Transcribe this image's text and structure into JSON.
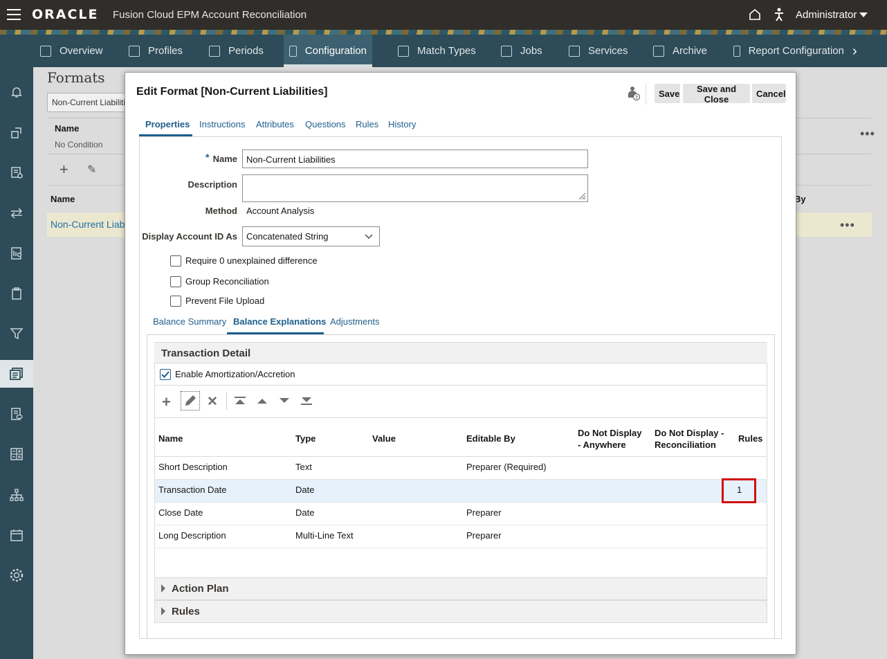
{
  "header": {
    "logo": "ORACLE",
    "app_title": "Fusion Cloud EPM Account Reconciliation",
    "user": "Administrator",
    "icons": [
      "menu-icon",
      "home-icon",
      "accessibility-icon",
      "chevron-down-icon"
    ]
  },
  "nav": {
    "items": [
      {
        "label": "Overview",
        "icon": "cube-icon"
      },
      {
        "label": "Profiles",
        "icon": "clipboard-icon"
      },
      {
        "label": "Periods",
        "icon": "sliders-icon"
      },
      {
        "label": "Configuration",
        "icon": "tools-icon",
        "active": true
      },
      {
        "label": "Match Types",
        "icon": "document-arrow-icon"
      },
      {
        "label": "Jobs",
        "icon": "clipboard-icon"
      },
      {
        "label": "Services",
        "icon": "toolbox-icon"
      },
      {
        "label": "Archive",
        "icon": "location-pin-icon"
      },
      {
        "label": "Report Configuration",
        "icon": "report-icon"
      }
    ]
  },
  "background": {
    "title": "Formats",
    "selector_value": "Non-Current Liabilities",
    "name_header": "Name",
    "no_condition": "No Condition",
    "table_name_header": "Name",
    "table_by_header": "By",
    "row_name": "Non-Current Liabilities"
  },
  "dialog": {
    "title": "Edit Format [Non-Current Liabilities]",
    "buttons": {
      "save": "Save",
      "save_close": "Save and Close",
      "cancel": "Cancel"
    },
    "tabs": [
      "Properties",
      "Instructions",
      "Attributes",
      "Questions",
      "Rules",
      "History"
    ],
    "active_tab": "Properties",
    "form": {
      "required_mark": "*",
      "name_label": "Name",
      "name_value": "Non-Current Liabilities",
      "description_label": "Description",
      "description_value": "",
      "method_label": "Method",
      "method_value": "Account Analysis",
      "display_label": "Display Account ID As",
      "display_value": "Concatenated String",
      "checkboxes": [
        {
          "label": "Require 0 unexplained difference",
          "checked": false
        },
        {
          "label": "Group Reconciliation",
          "checked": false
        },
        {
          "label": "Prevent File Upload",
          "checked": false
        }
      ]
    },
    "subtabs": [
      "Balance Summary",
      "Balance Explanations",
      "Adjustments"
    ],
    "active_subtab": "Balance Explanations",
    "transaction_detail": {
      "heading": "Transaction Detail",
      "enable_label": "Enable Amortization/Accretion",
      "enable_checked": true,
      "columns": [
        "Name",
        "Type",
        "Value",
        "Editable By",
        "Do Not Display - Anywhere",
        "Do Not Display - Reconciliation",
        "Rules"
      ],
      "column_lines": {
        "dnd_anywhere": [
          "Do Not Display",
          "- Anywhere"
        ],
        "dnd_recon": [
          "Do Not Display -",
          "Reconciliation"
        ]
      },
      "rows": [
        {
          "name": "Short Description",
          "type": "Text",
          "value": "",
          "editable_by": "Preparer (Required)",
          "rules": ""
        },
        {
          "name": "Transaction Date",
          "type": "Date",
          "value": "",
          "editable_by": "",
          "rules": "1"
        },
        {
          "name": "Close Date",
          "type": "Date",
          "value": "",
          "editable_by": "Preparer",
          "rules": ""
        },
        {
          "name": "Long Description",
          "type": "Multi-Line Text",
          "value": "",
          "editable_by": "Preparer",
          "rules": ""
        }
      ],
      "highlight_color": "#d10f0f"
    },
    "collapsed_sections": [
      "Action Plan",
      "Rules"
    ]
  }
}
